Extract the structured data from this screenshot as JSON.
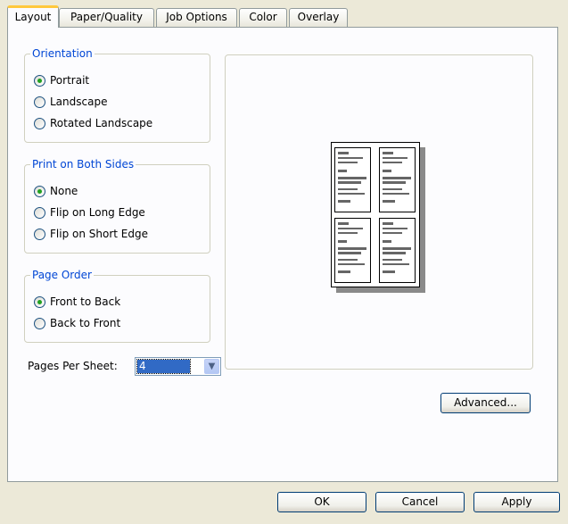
{
  "tabs": [
    {
      "label": "Layout",
      "active": true
    },
    {
      "label": "Paper/Quality",
      "active": false
    },
    {
      "label": "Job Options",
      "active": false
    },
    {
      "label": "Color",
      "active": false
    },
    {
      "label": "Overlay",
      "active": false
    }
  ],
  "orientation": {
    "title": "Orientation",
    "options": [
      {
        "label": "Portrait",
        "checked": true
      },
      {
        "label": "Landscape",
        "checked": false
      },
      {
        "label": "Rotated Landscape",
        "checked": false
      }
    ]
  },
  "both_sides": {
    "title": "Print on Both Sides",
    "options": [
      {
        "label": "None",
        "checked": true
      },
      {
        "label": "Flip on Long Edge",
        "checked": false
      },
      {
        "label": "Flip on Short Edge",
        "checked": false
      }
    ]
  },
  "page_order": {
    "title": "Page Order",
    "options": [
      {
        "label": "Front to Back",
        "checked": true
      },
      {
        "label": "Back to Front",
        "checked": false
      }
    ]
  },
  "pages_per_sheet": {
    "label": "Pages Per Sheet:",
    "value": "4"
  },
  "buttons": {
    "advanced": "Advanced...",
    "ok": "OK",
    "cancel": "Cancel",
    "apply": "Apply"
  },
  "icons": {
    "select_arrow": "chevron-down-icon"
  },
  "colors": {
    "accent_tab": "#ffc83c",
    "legend_text": "#0046d5",
    "selection": "#316ac5",
    "checked_dot": "#21a121"
  }
}
